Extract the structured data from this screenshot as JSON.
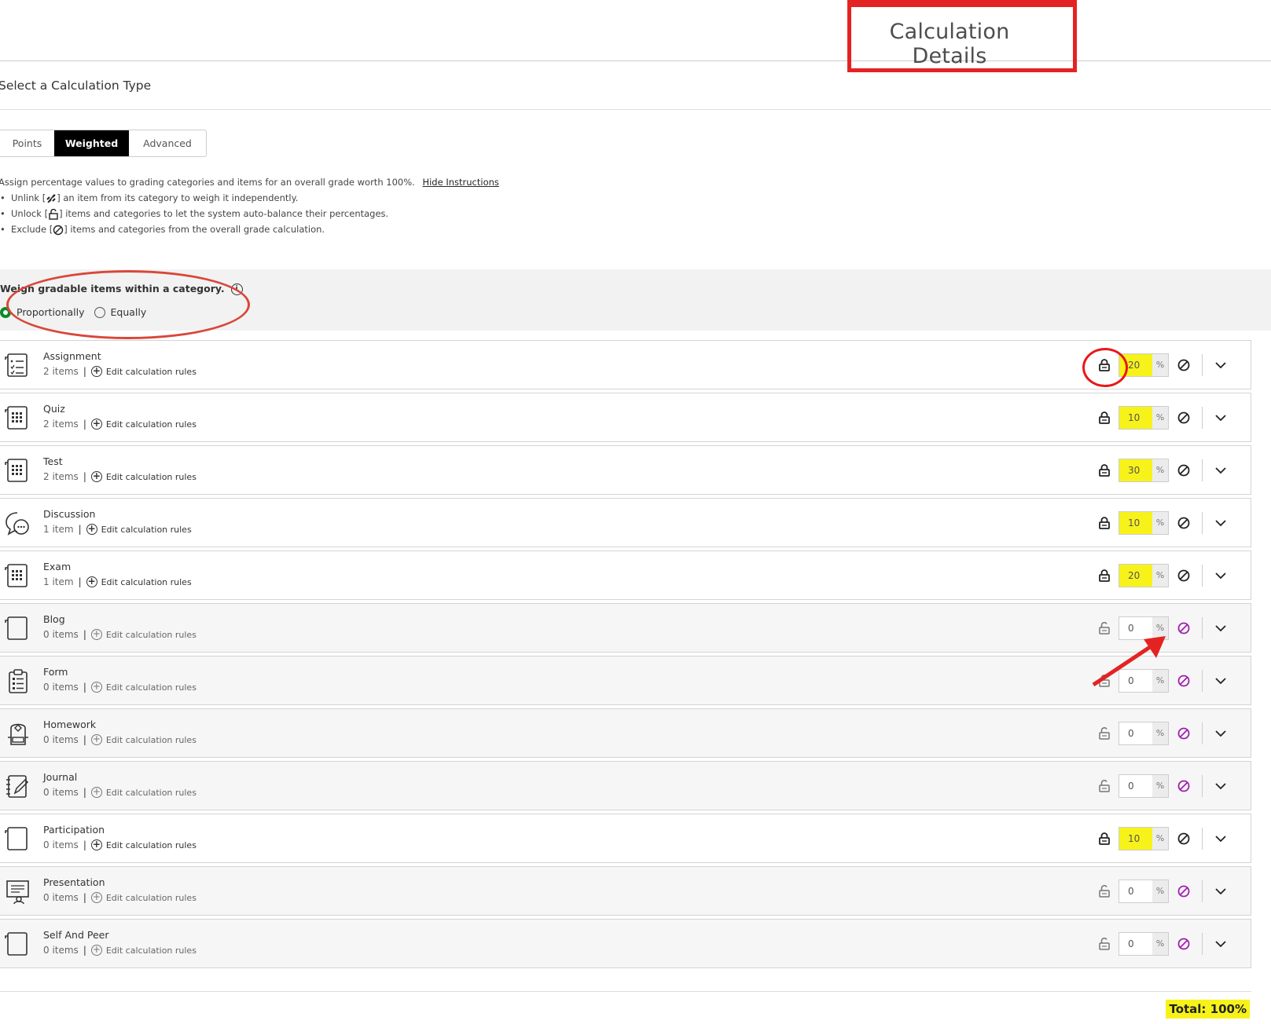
{
  "header": {
    "title": "Calculation Details"
  },
  "calc_type": {
    "heading": "Select a Calculation Type",
    "options": [
      "Points",
      "Weighted",
      "Advanced"
    ],
    "selected": "Weighted"
  },
  "instructions": {
    "text": "Assign percentage values to grading categories and items for an overall grade worth 100%.",
    "hide_link": "Hide Instructions",
    "bullets": [
      {
        "before": "Unlink [",
        "after": "] an item from its category to weigh it independently.",
        "icon": "unlink-icon"
      },
      {
        "before": "Unlock [",
        "after": "] items and categories to let the system auto-balance their percentages.",
        "icon": "unlock-icon"
      },
      {
        "before": "Exclude [",
        "after": "] items and categories from the overall grade calculation.",
        "icon": "exclude-icon"
      }
    ]
  },
  "weigh": {
    "label": "Weigh gradable items within a category.",
    "options": [
      "Proportionally",
      "Equally"
    ],
    "selected": "Proportionally"
  },
  "edit_rules_label": "Edit calculation rules",
  "percent_unit": "%",
  "categories": [
    {
      "name": "Assignment",
      "count": "2 items",
      "value": "20",
      "locked": true,
      "icon": "assignment-icon"
    },
    {
      "name": "Quiz",
      "count": "2 items",
      "value": "10",
      "locked": true,
      "icon": "quiz-icon"
    },
    {
      "name": "Test",
      "count": "2 items",
      "value": "30",
      "locked": true,
      "icon": "test-icon"
    },
    {
      "name": "Discussion",
      "count": "1 item",
      "value": "10",
      "locked": true,
      "icon": "discussion-icon"
    },
    {
      "name": "Exam",
      "count": "1 item",
      "value": "20",
      "locked": true,
      "icon": "exam-icon"
    },
    {
      "name": "Blog",
      "count": "0 items",
      "value": "0",
      "locked": false,
      "icon": "blog-icon"
    },
    {
      "name": "Form",
      "count": "0 items",
      "value": "0",
      "locked": false,
      "icon": "form-icon"
    },
    {
      "name": "Homework",
      "count": "0 items",
      "value": "0",
      "locked": false,
      "icon": "homework-icon"
    },
    {
      "name": "Journal",
      "count": "0 items",
      "value": "0",
      "locked": false,
      "icon": "journal-icon"
    },
    {
      "name": "Participation",
      "count": "0 items",
      "value": "10",
      "locked": true,
      "icon": "participation-icon"
    },
    {
      "name": "Presentation",
      "count": "0 items",
      "value": "0",
      "locked": false,
      "icon": "presentation-icon"
    },
    {
      "name": "Self And Peer",
      "count": "0 items",
      "value": "0",
      "locked": false,
      "icon": "self-and-peer-icon"
    }
  ],
  "total": "Total: 100%",
  "colors": {
    "highlight": "#f7f21a",
    "annotation_red": "#e52222",
    "excluded_purple": "#a01fb0",
    "radio_green": "#0a8a2a"
  }
}
